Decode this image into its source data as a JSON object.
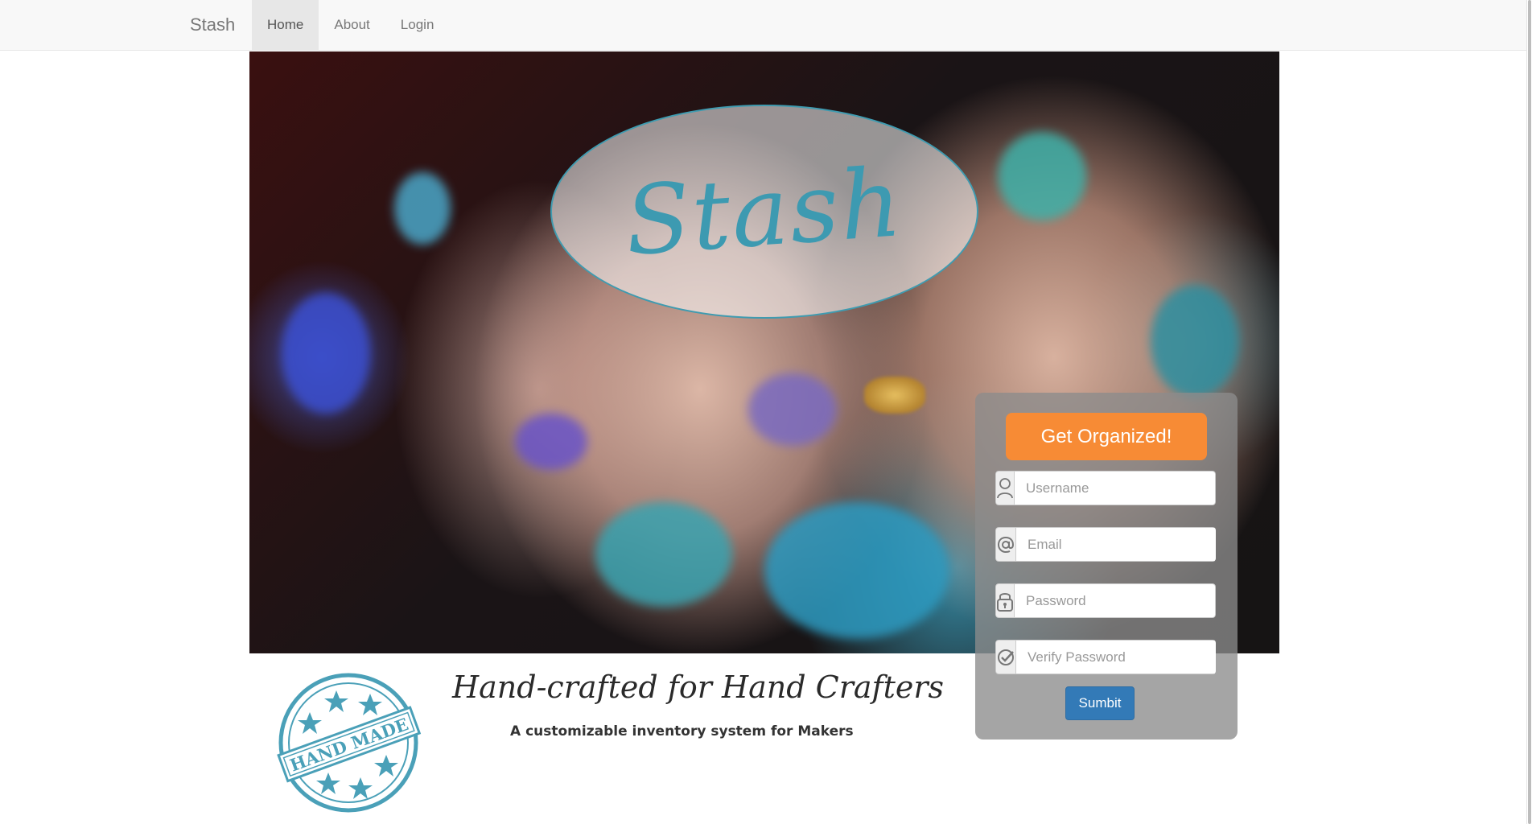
{
  "navbar": {
    "brand": "Stash",
    "items": [
      {
        "label": "Home",
        "active": true
      },
      {
        "label": "About",
        "active": false
      },
      {
        "label": "Login",
        "active": false
      }
    ]
  },
  "hero": {
    "logo_text": "Stash"
  },
  "signup": {
    "cta_label": "Get Organized!",
    "fields": [
      {
        "placeholder": "Username",
        "icon": "user-icon"
      },
      {
        "placeholder": "Email",
        "icon": "at-icon"
      },
      {
        "placeholder": "Password",
        "icon": "lock-icon"
      },
      {
        "placeholder": "Verify Password",
        "icon": "check-circle-icon"
      }
    ],
    "submit_label": "Sumbit"
  },
  "footer": {
    "stamp_text": "HAND MADE",
    "tagline": "Hand-crafted for Hand Crafters",
    "subtagline": "A customizable inventory system for Makers"
  },
  "colors": {
    "accent_orange": "#f78b35",
    "primary_blue": "#337ab7",
    "logo_teal": "#3d9ab1"
  }
}
